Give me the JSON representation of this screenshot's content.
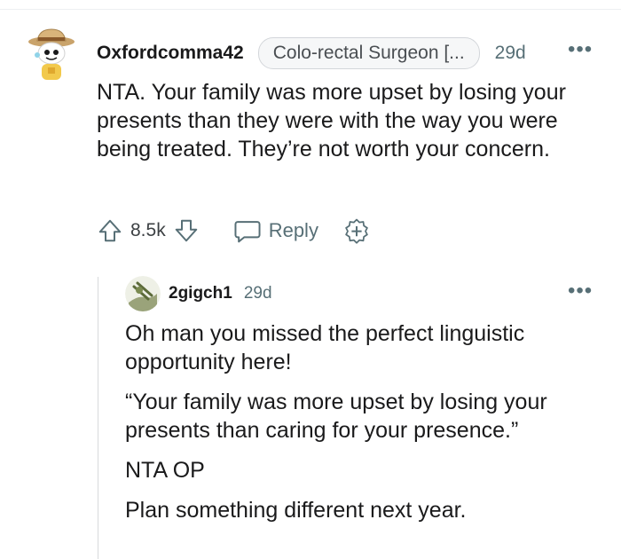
{
  "comment": {
    "username": "Oxfordcomma42",
    "flair": "Colo-rectal Surgeon [...",
    "time": "29d",
    "more": "•••",
    "body": "NTA. Your family was more upset by losing your presents than they were with the way you were being treated. They’re not worth your concern.",
    "score": "8.5k",
    "reply_label": "Reply"
  },
  "reply": {
    "username": "2gigch1",
    "time": "29d",
    "more": "•••",
    "paragraphs": [
      "Oh man you missed the perfect linguistic opportunity here!",
      "“Your family was more upset by losing your presents than caring for your presence.”",
      "NTA OP",
      "Plan something different next year."
    ]
  },
  "colors": {
    "meta": "#576f76",
    "text": "#1a1a1b",
    "thread_line": "#d7dadc"
  }
}
